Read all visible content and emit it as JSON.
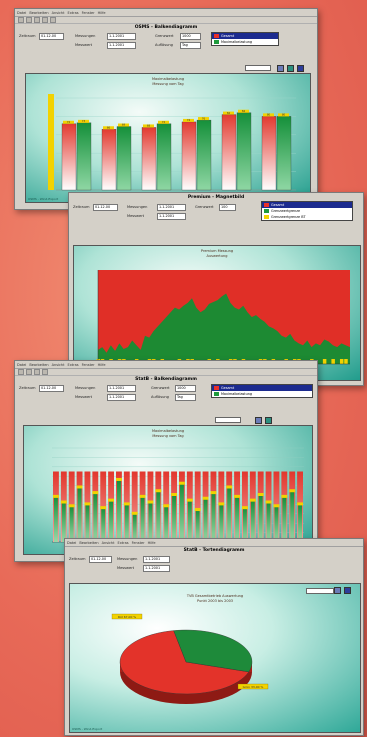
{
  "windows": [
    {
      "id": "w1",
      "title": "OSMS - Balkendiagramm",
      "menu": [
        "Datei",
        "Bearbeiten",
        "Ansicht",
        "Extras",
        "Fenster",
        "Hilfe"
      ],
      "fields": [
        {
          "label": "Zeitraum",
          "value": "01.12.00"
        },
        {
          "label": "Messungen",
          "value": "1.1.2001"
        },
        {
          "label": "Messwert",
          "value": "1.1.2001"
        },
        {
          "label": "Grenzwert",
          "value": "1000"
        },
        {
          "label": "Auflösung",
          "value": "Tag"
        }
      ],
      "legend": [
        "Gesamt",
        "Maximalbelastung"
      ],
      "chart_title": [
        "Maximalbelastung",
        "Messung vom Tag"
      ],
      "status": "OSMS - Wind-Export"
    },
    {
      "id": "w2",
      "title": "Premium - Magnetbild",
      "menu": [
        "Datei",
        "Bearbeiten",
        "Ansicht",
        "Extras",
        "Fenster",
        "Hilfe"
      ],
      "fields": [
        {
          "label": "Zeitraum",
          "value": "01.12.00"
        },
        {
          "label": "Messungen",
          "value": "1.1.2001"
        },
        {
          "label": "Messwert",
          "value": "1.1.2001"
        },
        {
          "label": "Grenzwert",
          "value": "100"
        }
      ],
      "legend": [
        "Gesamt",
        "Grenzwertgrenze",
        "Grenzwertgrenze BT"
      ],
      "chart_title": [
        "Premium Messung",
        "Auswertung"
      ]
    },
    {
      "id": "w3",
      "title": "StatB - Balkendiagramm",
      "menu": [
        "Datei",
        "Bearbeiten",
        "Ansicht",
        "Extras",
        "Fenster",
        "Hilfe"
      ],
      "fields": [
        {
          "label": "Zeitraum",
          "value": "01.12.00"
        },
        {
          "label": "Messungen",
          "value": "1.1.2001"
        },
        {
          "label": "Messwert",
          "value": "1.1.2001"
        },
        {
          "label": "Grenzwert",
          "value": "1000"
        },
        {
          "label": "Auflösung",
          "value": "Tag"
        }
      ],
      "legend": [
        "Gesamt",
        "Maximalbelastung"
      ],
      "chart_title": [
        "Maximalbelastung",
        "Messung vom Tag"
      ]
    },
    {
      "id": "w4",
      "title": "StatB - Tortendiagramm",
      "menu": [
        "Datei",
        "Bearbeiten",
        "Ansicht",
        "Extras",
        "Fenster",
        "Hilfe"
      ],
      "fields": [
        {
          "label": "Zeitraum",
          "value": "01.12.00"
        },
        {
          "label": "Messungen",
          "value": "1.1.2001"
        },
        {
          "label": "Messwert",
          "value": "1.1.2001"
        }
      ],
      "chart_title": [
        "TVB Gesamtbetrieb Auswertung",
        "Punkt 2003 bis 2003"
      ],
      "pie_labels": [
        "Rot 67,00 %",
        "Grün 33,00 %"
      ],
      "status": "OSMS - Wind-Export"
    }
  ],
  "chart_data": [
    {
      "type": "bar",
      "categories": [
        "1",
        "2",
        "3",
        "4",
        "5",
        "6"
      ],
      "series": [
        {
          "name": "Gesamt",
          "values": [
            72,
            66,
            68,
            74,
            82,
            80
          ]
        },
        {
          "name": "Maximalbelastung",
          "values": [
            73,
            69,
            72,
            76,
            84,
            80
          ]
        }
      ],
      "ylim": [
        0,
        100
      ],
      "colors": {
        "red": "#e8302a",
        "green": "#1f9a3c"
      }
    },
    {
      "type": "area",
      "x_count": 60,
      "series": [
        {
          "name": "Grenzwertgrenze",
          "values": [
            15,
            18,
            12,
            20,
            14,
            22,
            16,
            18,
            25,
            20,
            15,
            30,
            28,
            35,
            40,
            45,
            50,
            55,
            60,
            58,
            62,
            65,
            70,
            60,
            55,
            58,
            64,
            66,
            68,
            72,
            75,
            65,
            60,
            58,
            62,
            55,
            50,
            52,
            48,
            45,
            40,
            38,
            35,
            30,
            28,
            32,
            25,
            22,
            20,
            25,
            18,
            22,
            20,
            26,
            24,
            20,
            18,
            22,
            20,
            18
          ]
        },
        {
          "name": "Gesamt",
          "values": [
            100,
            100,
            100,
            100,
            100,
            100,
            100,
            100,
            100,
            100,
            100,
            100,
            100,
            100,
            100,
            100,
            100,
            100,
            100,
            100,
            100,
            100,
            100,
            100,
            100,
            100,
            100,
            100,
            100,
            100,
            100,
            100,
            100,
            100,
            100,
            100,
            100,
            100,
            100,
            100,
            100,
            100,
            100,
            100,
            100,
            100,
            100,
            100,
            100,
            100,
            100,
            100,
            100,
            100,
            100,
            100,
            100,
            100,
            100,
            100
          ]
        }
      ],
      "markers": [
        1,
        1,
        0,
        1,
        0,
        1,
        1,
        0,
        0,
        1,
        0,
        0,
        1,
        1,
        0,
        1,
        0,
        0,
        0,
        1,
        0,
        1,
        1,
        0,
        0,
        0,
        1,
        0,
        1,
        0,
        0,
        1,
        1,
        0,
        1,
        0,
        0,
        0,
        1,
        1,
        0,
        1,
        0,
        0,
        1,
        0,
        1,
        1,
        0,
        0,
        1,
        0,
        0,
        1,
        0,
        1,
        0,
        1,
        1,
        0
      ],
      "ylim": [
        0,
        100
      ]
    },
    {
      "type": "bar",
      "categories": [
        "1",
        "2",
        "3",
        "4",
        "5",
        "6",
        "7",
        "8",
        "9",
        "10",
        "11",
        "12",
        "13",
        "14",
        "15",
        "16",
        "17",
        "18",
        "19",
        "20",
        "21",
        "22",
        "23",
        "24",
        "25",
        "26",
        "27",
        "28",
        "29",
        "30",
        "31",
        "32"
      ],
      "series": [
        {
          "name": "Gesamt",
          "values": [
            75,
            75,
            75,
            75,
            75,
            75,
            75,
            75,
            75,
            75,
            75,
            75,
            75,
            75,
            75,
            75,
            75,
            75,
            75,
            75,
            75,
            75,
            75,
            75,
            75,
            75,
            75,
            75,
            75,
            75,
            75,
            75
          ]
        },
        {
          "name": "Maximalbelastung",
          "values": [
            48,
            42,
            38,
            58,
            40,
            52,
            36,
            44,
            66,
            40,
            30,
            48,
            42,
            54,
            38,
            50,
            62,
            44,
            34,
            46,
            52,
            40,
            58,
            48,
            36,
            44,
            50,
            42,
            38,
            48,
            54,
            40
          ]
        }
      ],
      "ylim": [
        0,
        100
      ]
    },
    {
      "type": "pie",
      "categories": [
        "Rot",
        "Grün"
      ],
      "values": [
        67,
        33
      ],
      "colors": [
        "#e3332a",
        "#1e8a3a"
      ]
    }
  ]
}
